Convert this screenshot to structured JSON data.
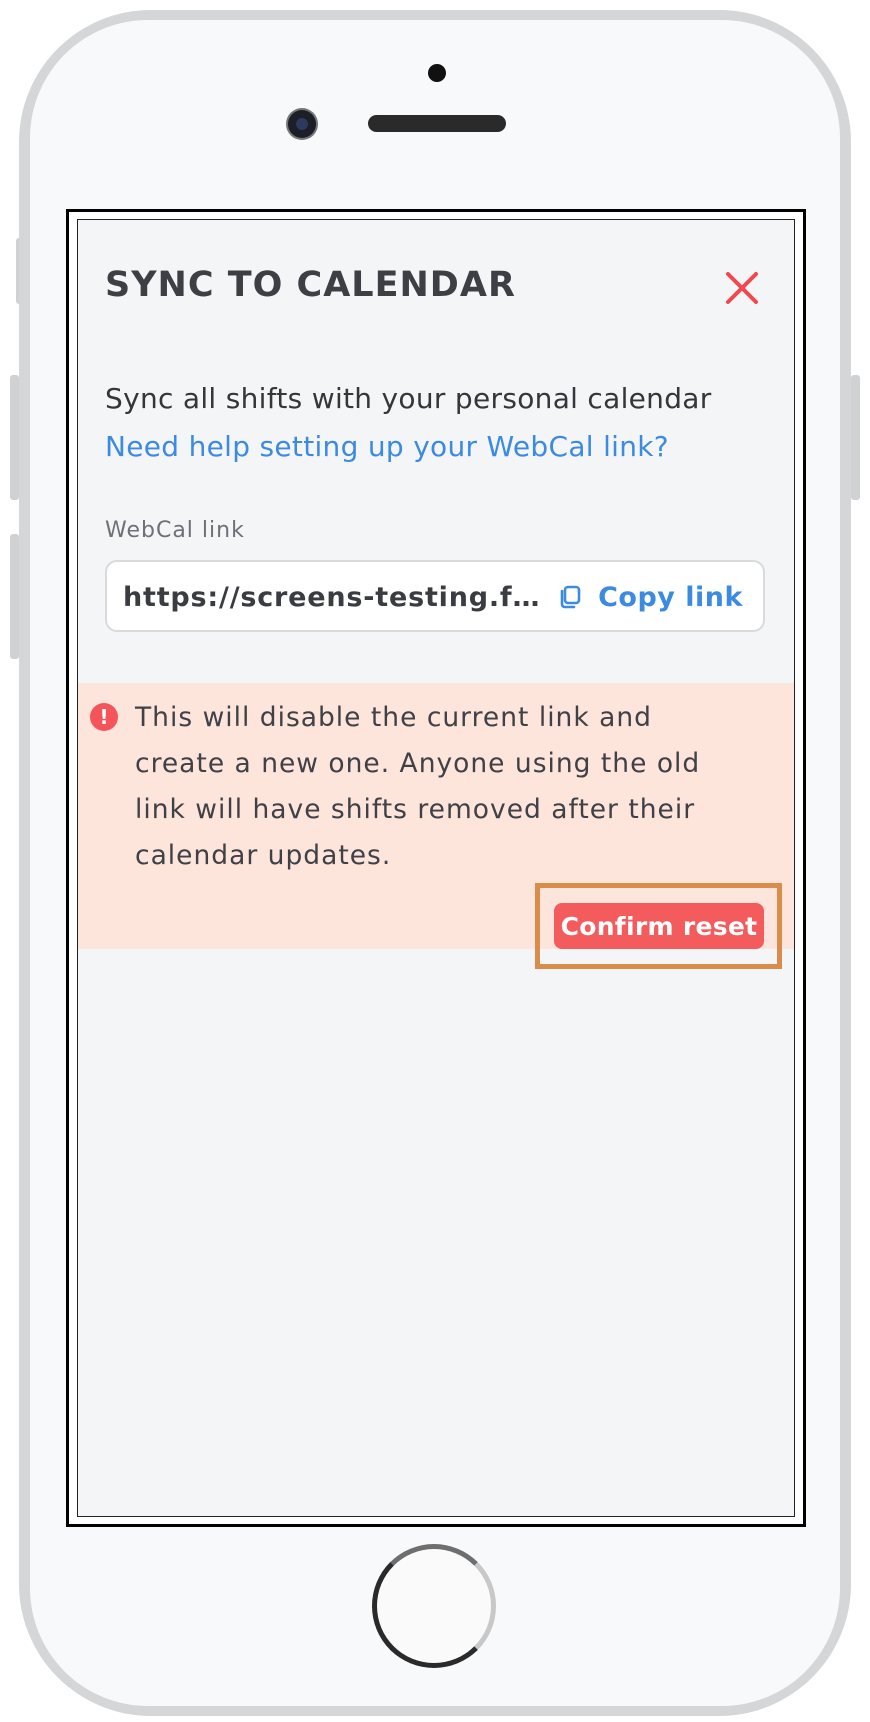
{
  "modal": {
    "title": "SYNC TO CALENDAR",
    "close_icon": "close-x-icon",
    "intro_text": "Sync all shifts with your personal calendar",
    "help_link": "Need help setting up your WebCal link?",
    "field_label": "WebCal link",
    "link_value": "https://screens-testing.fo…",
    "copy_icon": "copy-icon",
    "copy_label": "Copy link",
    "warning": {
      "icon": "exclamation-circle-icon",
      "icon_glyph": "!",
      "text": "This will disable the current link and create a new one. Anyone using the old link will have shifts removed after their calendar updates.",
      "confirm_label": "Confirm reset"
    }
  },
  "colors": {
    "accent_link": "#3d8be0",
    "danger": "#f45b5c",
    "warning_bg": "#fde5dc",
    "highlight_outline": "#da8c4a",
    "screen_bg": "#f4f5f7"
  }
}
